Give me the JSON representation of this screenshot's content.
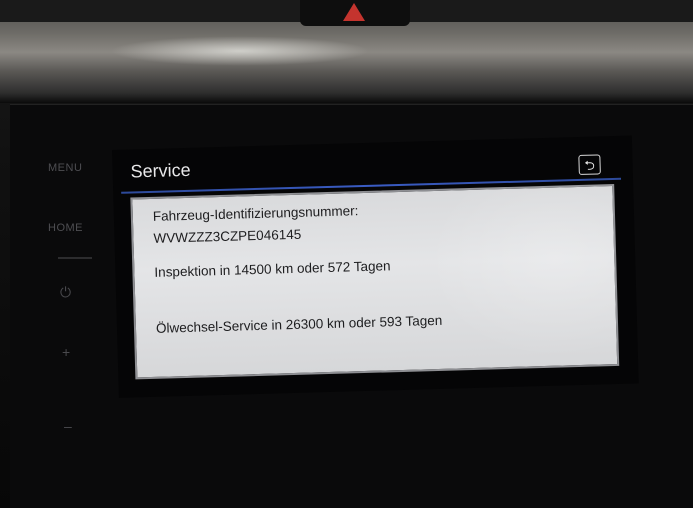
{
  "side_controls": {
    "menu_label": "MENU",
    "home_label": "HOME",
    "power_icon": "power-icon",
    "plus_icon": "plus-icon",
    "minus_icon": "minus-icon"
  },
  "screen": {
    "title": "Service",
    "back_icon": "back-arrow-icon",
    "info": {
      "vin_label": "Fahrzeug-Identifizierungsnummer:",
      "vin_value": "WVWZZZ3CZPE046145",
      "inspection": "Inspektion in 14500 km oder 572 Tagen",
      "oil_service": "Ölwechsel-Service in 26300 km oder 593 Tagen"
    }
  },
  "colors": {
    "accent_rule": "#3a5cc4",
    "panel_bg": "#e0e1e3",
    "hazard_red": "#c4342e"
  }
}
